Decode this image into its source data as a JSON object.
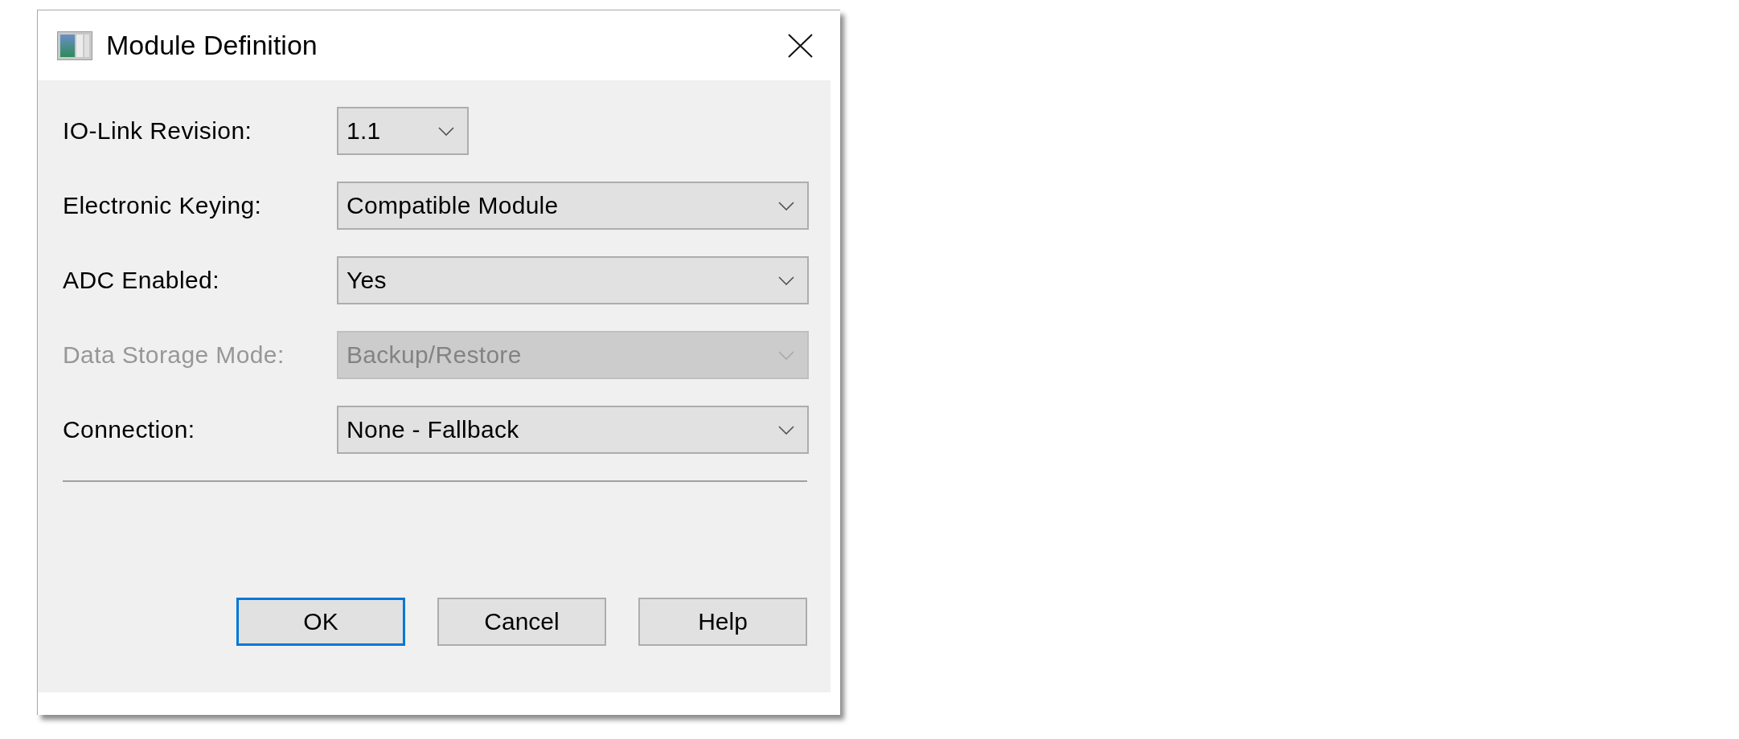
{
  "window": {
    "title": "Module Definition"
  },
  "fields": [
    {
      "label": "IO-Link Revision:",
      "value": "1.1",
      "disabled": false
    },
    {
      "label": "Electronic Keying:",
      "value": "Compatible Module",
      "disabled": false
    },
    {
      "label": "ADC Enabled:",
      "value": "Yes",
      "disabled": false
    },
    {
      "label": "Data Storage Mode:",
      "value": "Backup/Restore",
      "disabled": true
    },
    {
      "label": "Connection:",
      "value": "None - Fallback",
      "disabled": false
    }
  ],
  "buttons": [
    {
      "label": "OK",
      "focused": true
    },
    {
      "label": "Cancel",
      "focused": false
    },
    {
      "label": "Help",
      "focused": false
    }
  ]
}
